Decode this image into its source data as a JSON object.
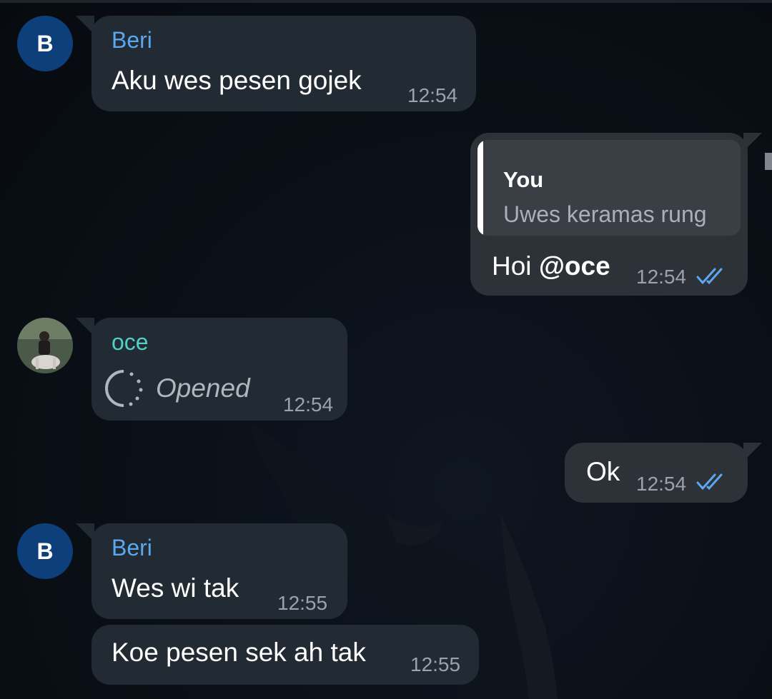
{
  "messages": [
    {
      "sender": "Beri",
      "avatar_letter": "B",
      "text": "Aku wes pesen gojek",
      "time": "12:54"
    },
    {
      "sender": "You",
      "reply_to": {
        "name": "You",
        "text": "Uwes keramas rung"
      },
      "text_plain": "Hoi ",
      "text_mention": "@oce",
      "time": "12:54",
      "status": "read-double-check"
    },
    {
      "sender": "oce",
      "text": "Opened",
      "time": "12:54",
      "type": "view-once-opened"
    },
    {
      "sender": "You",
      "text": "Ok",
      "time": "12:54",
      "status": "read-double-check"
    },
    {
      "sender": "Beri",
      "avatar_letter": "B",
      "text": "Wes wi tak",
      "time": "12:55"
    },
    {
      "sender": "Beri",
      "text": "Koe pesen sek ah tak",
      "time": "12:55"
    }
  ],
  "colors": {
    "incoming_bubble": "#222a33",
    "outgoing_bubble": "#2d3238",
    "sender_beri": "#5aa9f0",
    "sender_oce": "#4fd1c5",
    "read_ticks": "#5aa9f0",
    "avatar_bg": "#0d3f7a"
  }
}
